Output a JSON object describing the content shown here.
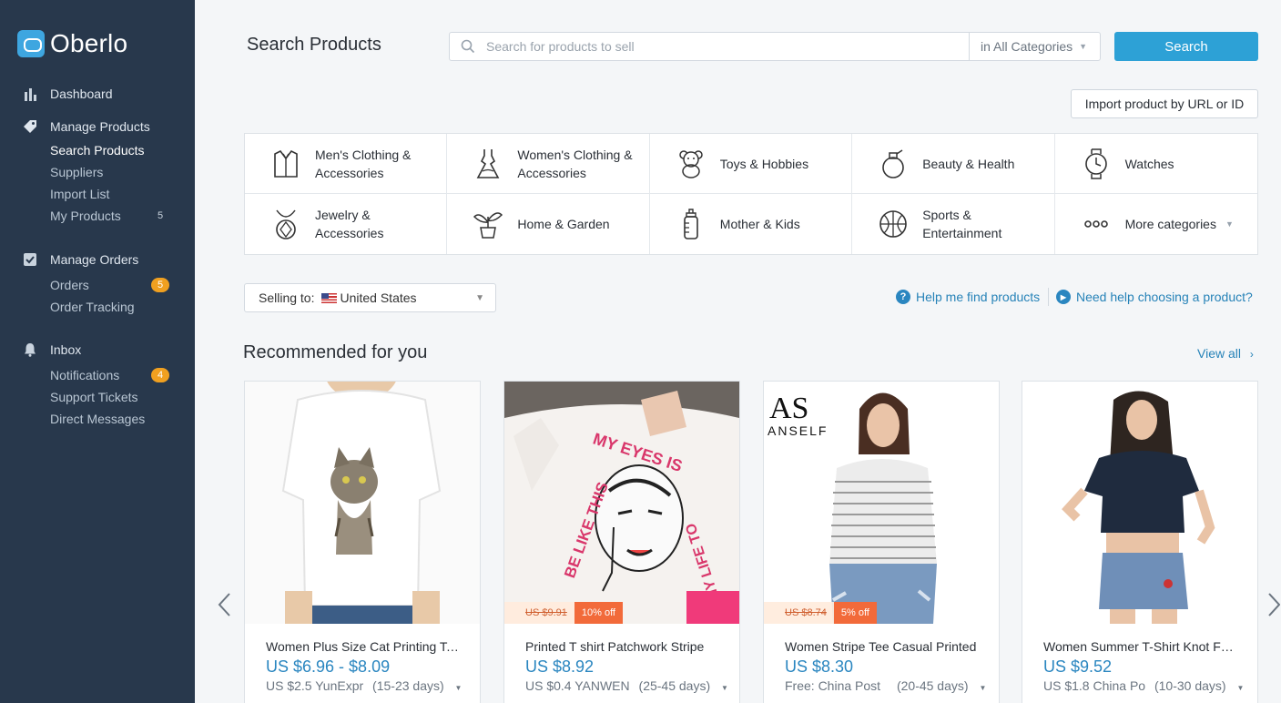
{
  "brand": {
    "name": "Oberlo"
  },
  "sidebar": {
    "dashboard": {
      "label": "Dashboard"
    },
    "manage_products": {
      "label": "Manage Products",
      "items": [
        {
          "label": "Search Products"
        },
        {
          "label": "Suppliers"
        },
        {
          "label": "Import List"
        },
        {
          "label": "My Products",
          "badge": "5"
        }
      ]
    },
    "manage_orders": {
      "label": "Manage Orders",
      "items": [
        {
          "label": "Orders",
          "badge": "5"
        },
        {
          "label": "Order Tracking"
        }
      ]
    },
    "inbox": {
      "label": "Inbox",
      "items": [
        {
          "label": "Notifications",
          "badge": "4"
        },
        {
          "label": "Support Tickets"
        },
        {
          "label": "Direct Messages"
        }
      ]
    }
  },
  "header": {
    "title": "Search Products",
    "search_placeholder": "Search for products to sell",
    "category_select": "in All Categories",
    "search_button": "Search",
    "import_button": "Import product by URL or ID"
  },
  "categories": [
    {
      "label": "Men's Clothing & Accessories",
      "icon": "shirt-icon"
    },
    {
      "label": "Women's Clothing & Accessories",
      "icon": "dress-icon"
    },
    {
      "label": "Toys & Hobbies",
      "icon": "teddy-bear-icon"
    },
    {
      "label": "Beauty & Health",
      "icon": "perfume-icon"
    },
    {
      "label": "Watches",
      "icon": "watch-icon"
    },
    {
      "label": "Jewelry & Accessories",
      "icon": "necklace-icon"
    },
    {
      "label": "Home & Garden",
      "icon": "plant-icon"
    },
    {
      "label": "Mother & Kids",
      "icon": "baby-bottle-icon"
    },
    {
      "label": "Sports & Entertainment",
      "icon": "ball-icon"
    },
    {
      "label": "More categories",
      "icon": "more-dots-icon"
    }
  ],
  "selling_to": {
    "label": "Selling to:",
    "country": "United States"
  },
  "help_links": {
    "find": "Help me find products",
    "choosing": "Need help choosing a product?"
  },
  "recommended": {
    "title": "Recommended for you",
    "view_all": "View all",
    "products": [
      {
        "title": "Women Plus Size Cat Printing Tee",
        "price": "US $6.96 - $8.09",
        "shipping_cost": "US $2.5 YunExpr",
        "shipping_time": "(15-23 days)",
        "old_price": "",
        "discount": ""
      },
      {
        "title": "Printed T shirt Patchwork Stripe",
        "price": "US $8.92",
        "shipping_cost": "US $0.4 YANWEN",
        "shipping_time": "(25-45 days)",
        "old_price": "US $9.91",
        "discount": "10% off"
      },
      {
        "title": "Women Stripe Tee Casual Printed",
        "price": "US $8.30",
        "shipping_cost": "Free: China Post",
        "shipping_time": "(20-45 days)",
        "old_price": "US $8.74",
        "discount": "5% off"
      },
      {
        "title": "Women Summer T-Shirt Knot Front",
        "price": "US $9.52",
        "shipping_cost": "US $1.8 China Po",
        "shipping_time": "(10-30 days)",
        "old_price": "",
        "discount": ""
      }
    ],
    "card2_print": [
      "MY EYES IS",
      "BE LIKE THIS",
      "MY LIFE TO"
    ],
    "card3_logo": [
      "AS",
      "ANSELF"
    ]
  }
}
